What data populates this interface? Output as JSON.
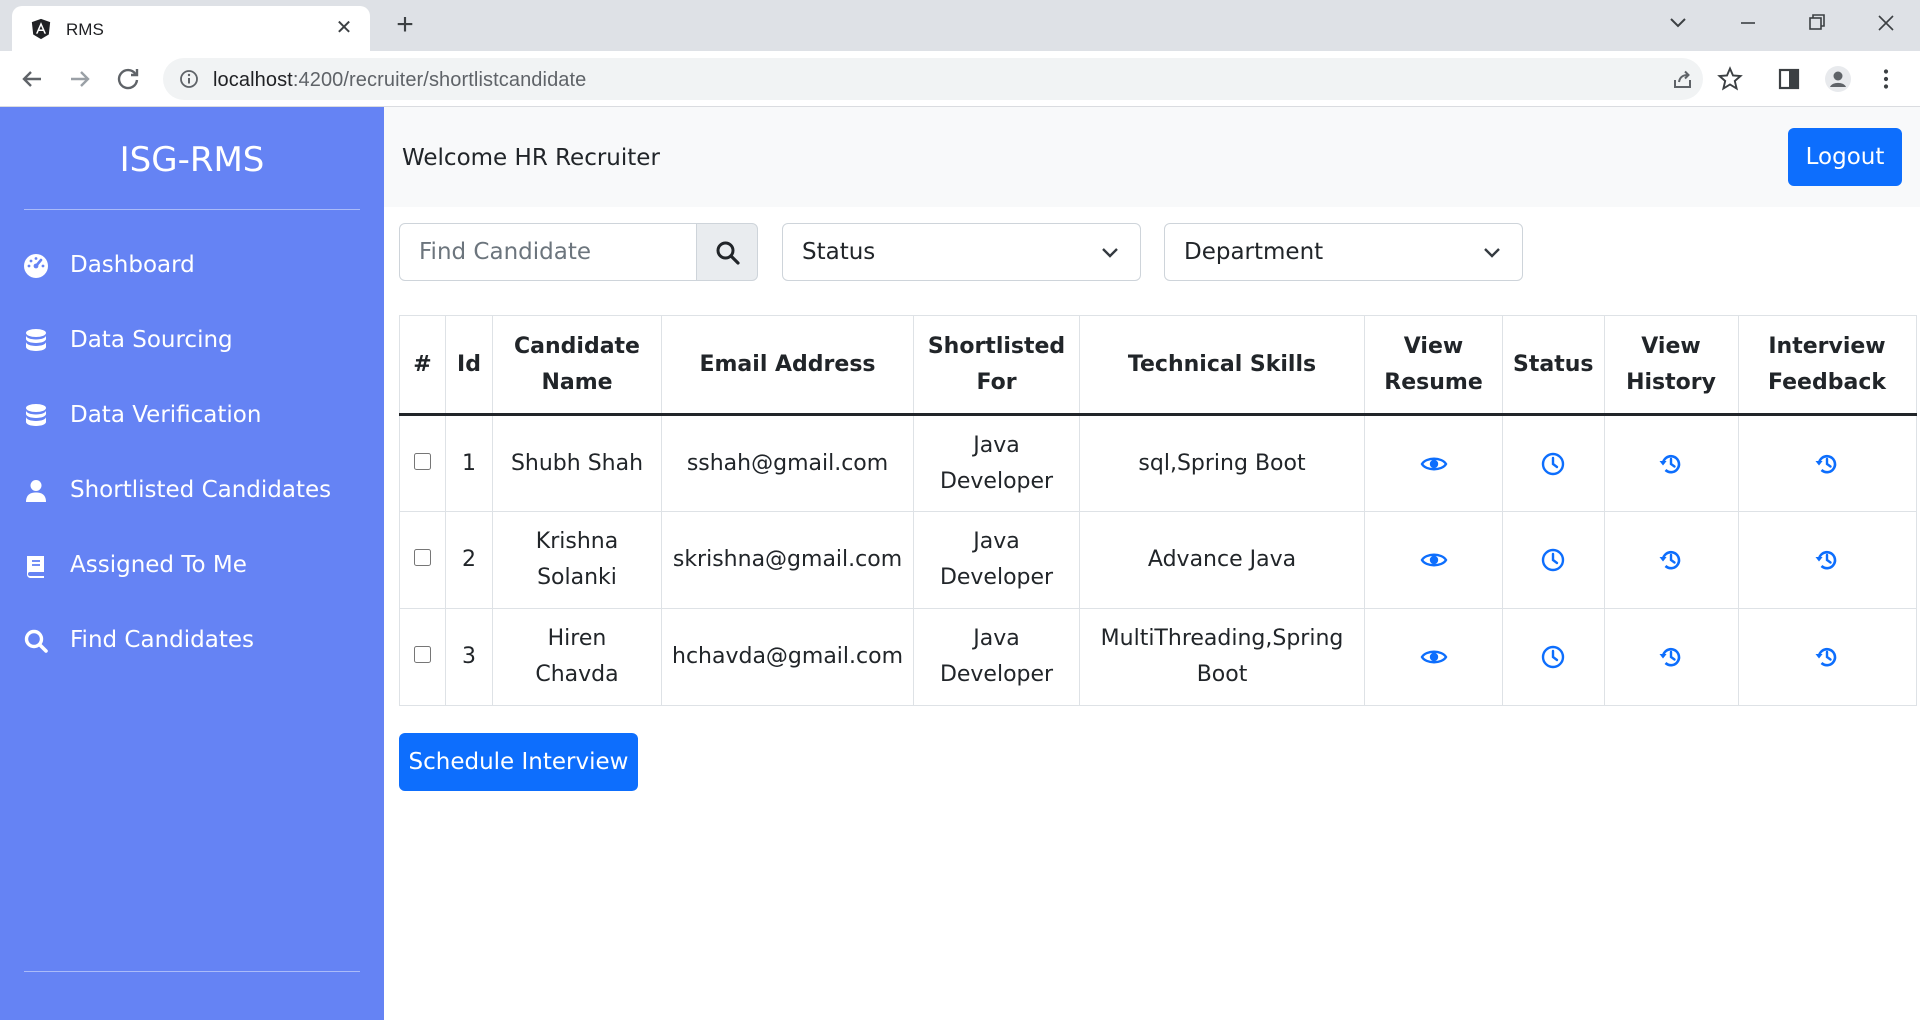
{
  "browser": {
    "tab_title": "RMS",
    "url_host": "localhost",
    "url_path": ":4200/recruiter/shortlistcandidate"
  },
  "sidebar": {
    "brand": "ISG-RMS",
    "items": [
      {
        "label": "Dashboard",
        "icon": "tachometer-icon"
      },
      {
        "label": "Data Sourcing",
        "icon": "database-icon"
      },
      {
        "label": "Data Verification",
        "icon": "database-icon"
      },
      {
        "label": "Shortlisted Candidates",
        "icon": "user-icon"
      },
      {
        "label": "Assigned To Me",
        "icon": "book-icon"
      },
      {
        "label": "Find Candidates",
        "icon": "search-icon"
      }
    ]
  },
  "header": {
    "welcome": "Welcome HR Recruiter",
    "logout_label": "Logout"
  },
  "filters": {
    "search_placeholder": "Find Candidate",
    "status_selected": "Status",
    "department_selected": "Department"
  },
  "table": {
    "headers": [
      "#",
      "Id",
      "Candidate Name",
      "Email Address",
      "Shortlisted For",
      "Technical Skills",
      "View Resume",
      "Status",
      "View History",
      "Interview Feedback"
    ],
    "rows": [
      {
        "id": "1",
        "name": "Shubh Shah",
        "email": "sshah@gmail.com",
        "role": "Java Developer",
        "skills": "sql,Spring Boot",
        "checked": false
      },
      {
        "id": "2",
        "name": "Krishna Solanki",
        "email": "skrishna@gmail.com",
        "role": "Java Developer",
        "skills": "Advance Java",
        "checked": false
      },
      {
        "id": "3",
        "name": "Hiren Chavda",
        "email": "hchavda@gmail.com",
        "role": "Java Developer",
        "skills": "MultiThreading,Spring Boot",
        "checked": false
      }
    ]
  },
  "actions": {
    "schedule_label": "Schedule Interview"
  },
  "colors": {
    "sidebar_bg": "#6583f4",
    "primary": "#0d6efd"
  }
}
